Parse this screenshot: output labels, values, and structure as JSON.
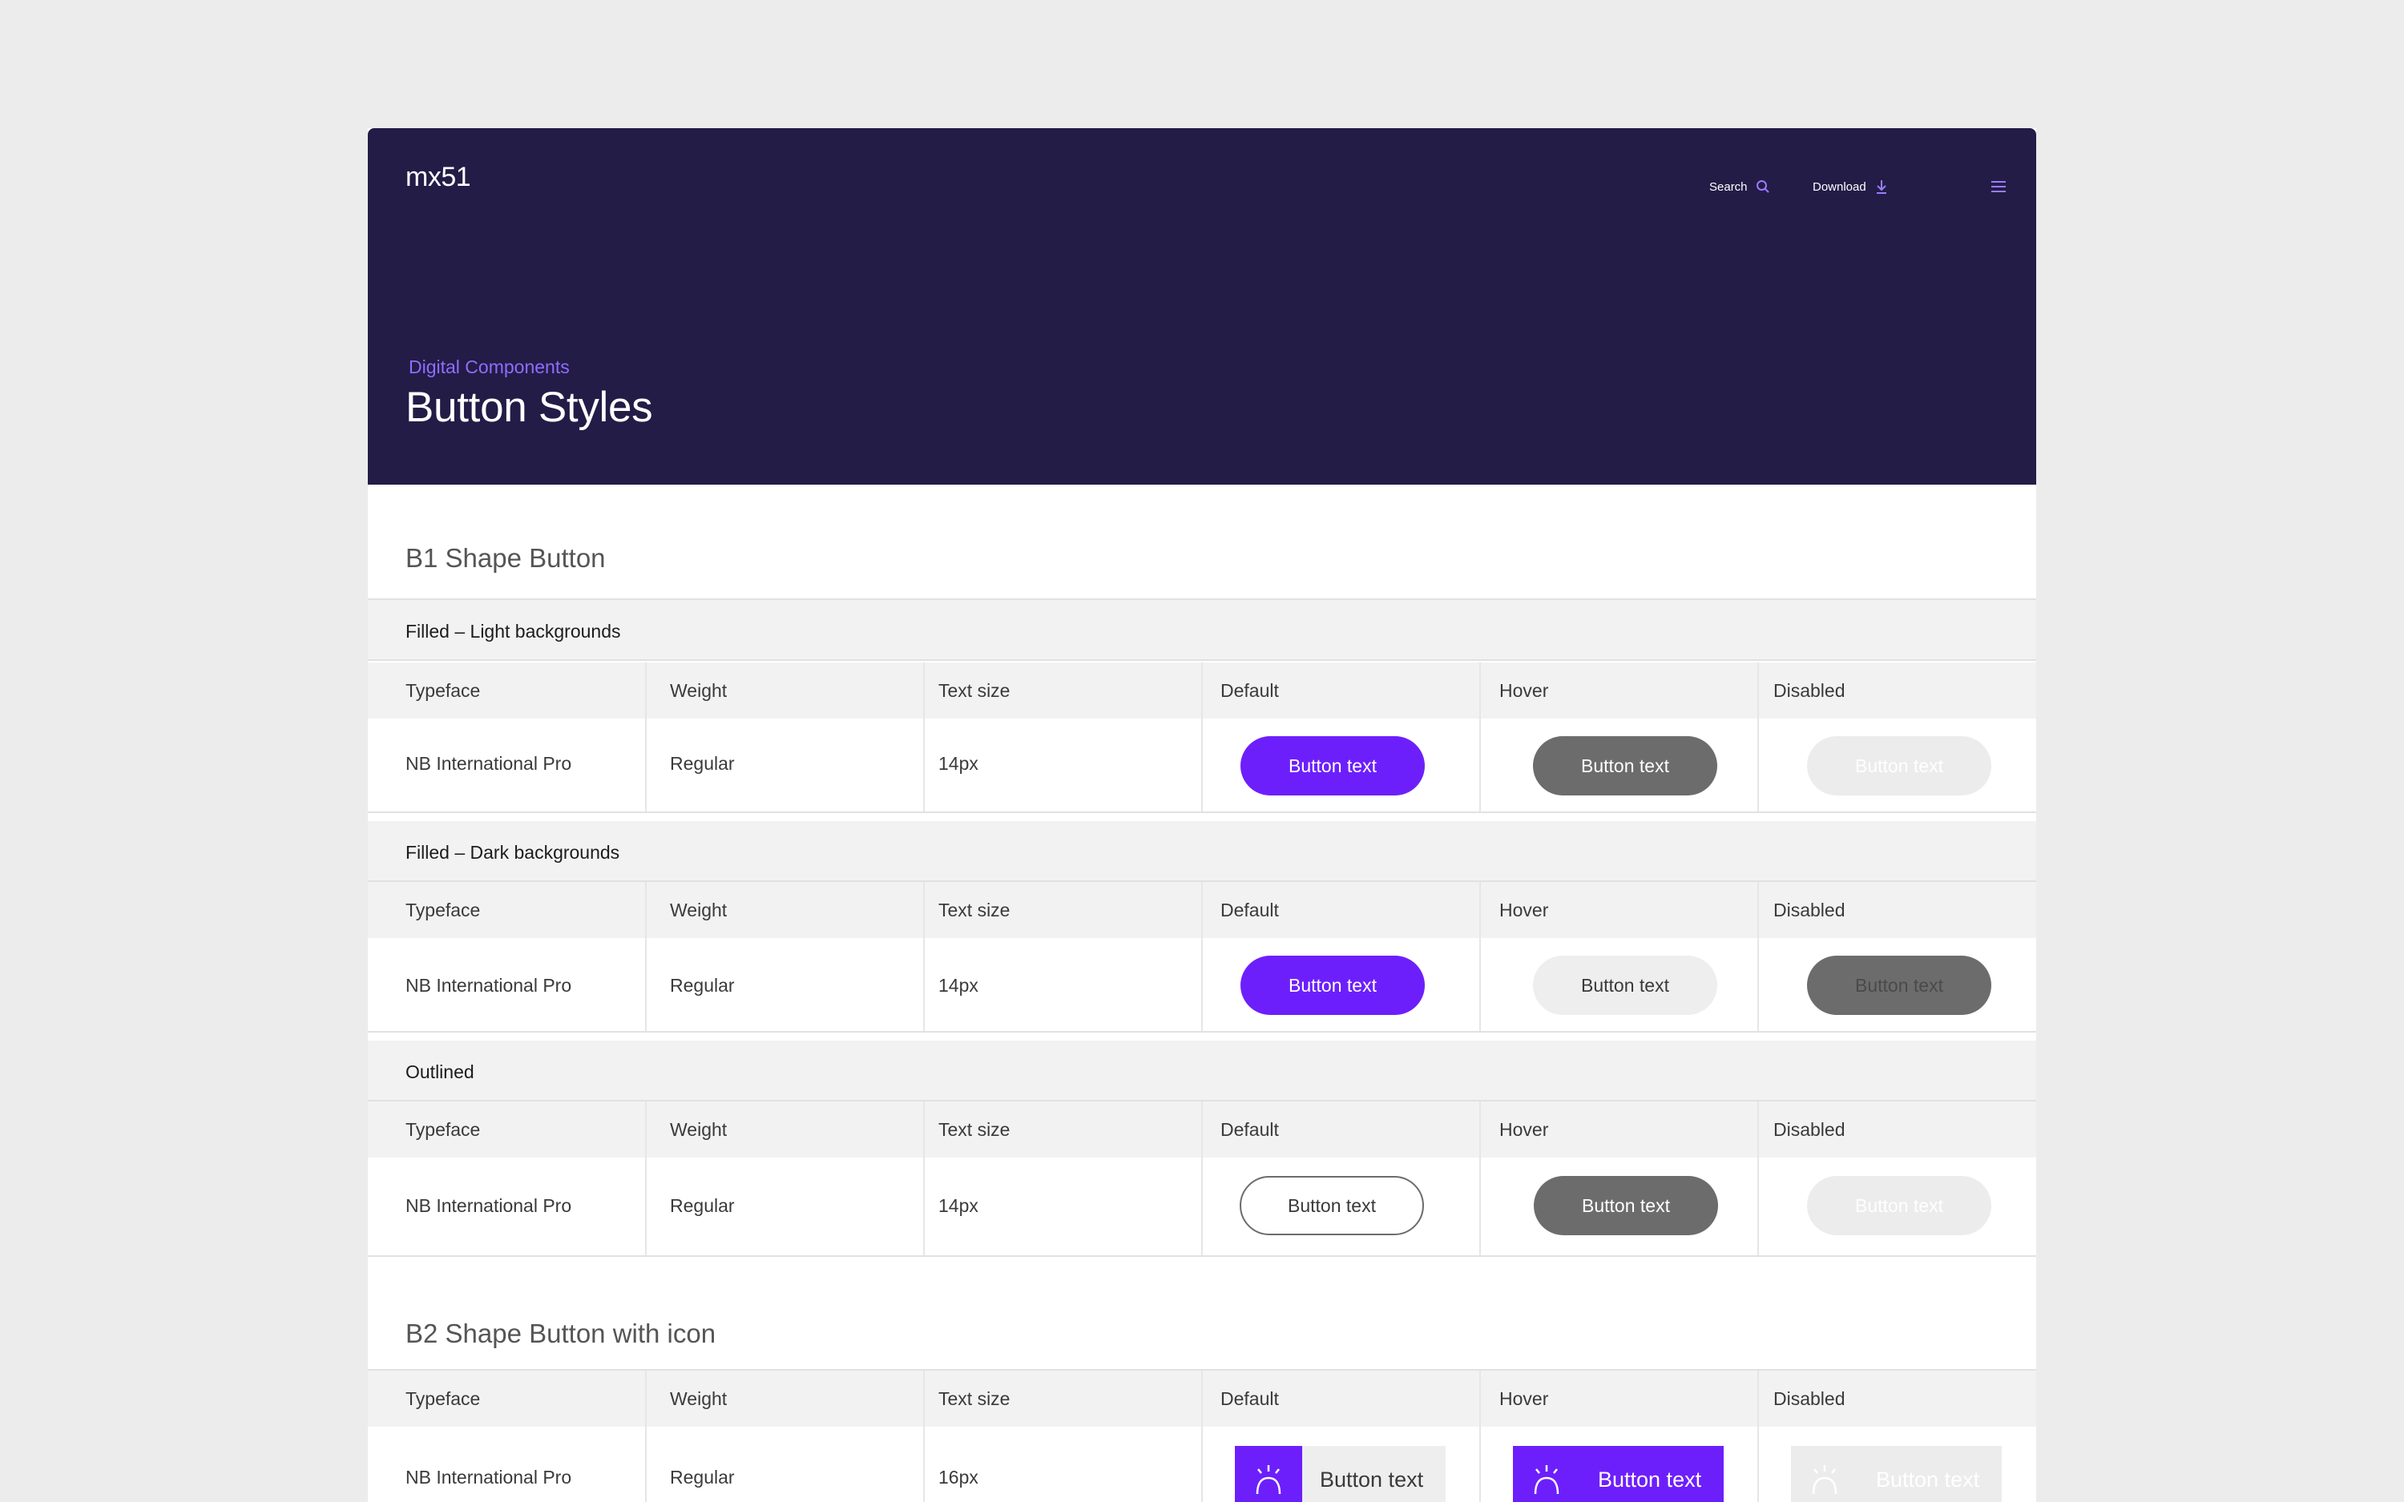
{
  "brand": {
    "logo": "mx51"
  },
  "nav": {
    "search_label": "Search",
    "download_label": "Download"
  },
  "hero": {
    "eyebrow": "Digital Components",
    "title": "Button Styles"
  },
  "columns": {
    "typeface": "Typeface",
    "weight": "Weight",
    "text_size": "Text size",
    "default": "Default",
    "hover": "Hover",
    "disabled": "Disabled"
  },
  "sections": {
    "b1": {
      "title": "B1 Shape Button",
      "groups": [
        {
          "label": "Filled – Light backgrounds",
          "typeface": "NB International Pro",
          "weight": "Regular",
          "size": "14px",
          "btn_default": "Button text",
          "btn_hover": "Button text",
          "btn_disabled": "Button text"
        },
        {
          "label": "Filled – Dark backgrounds",
          "typeface": "NB International Pro",
          "weight": "Regular",
          "size": "14px",
          "btn_default": "Button text",
          "btn_hover": "Button text",
          "btn_disabled": "Button text"
        },
        {
          "label": "Outlined",
          "typeface": "NB International Pro",
          "weight": "Regular",
          "size": "14px",
          "btn_default": "Button text",
          "btn_hover": "Button text",
          "btn_disabled": "Button text"
        }
      ]
    },
    "b2": {
      "title": "B2 Shape Button with icon",
      "row": {
        "typeface": "NB International Pro",
        "weight": "Regular",
        "size": "16px",
        "btn_default": "Button text",
        "btn_hover": "Button text",
        "btn_disabled": "Button text"
      }
    }
  },
  "colors": {
    "hero_bg": "#231c47",
    "accent": "#6d1ffb",
    "eyebrow": "#8f6cff",
    "hover_grey": "#6c6c6c",
    "page_bg": "#ebeceb"
  },
  "icons": [
    "search-icon",
    "download-icon",
    "menu-icon",
    "lamp-icon"
  ]
}
